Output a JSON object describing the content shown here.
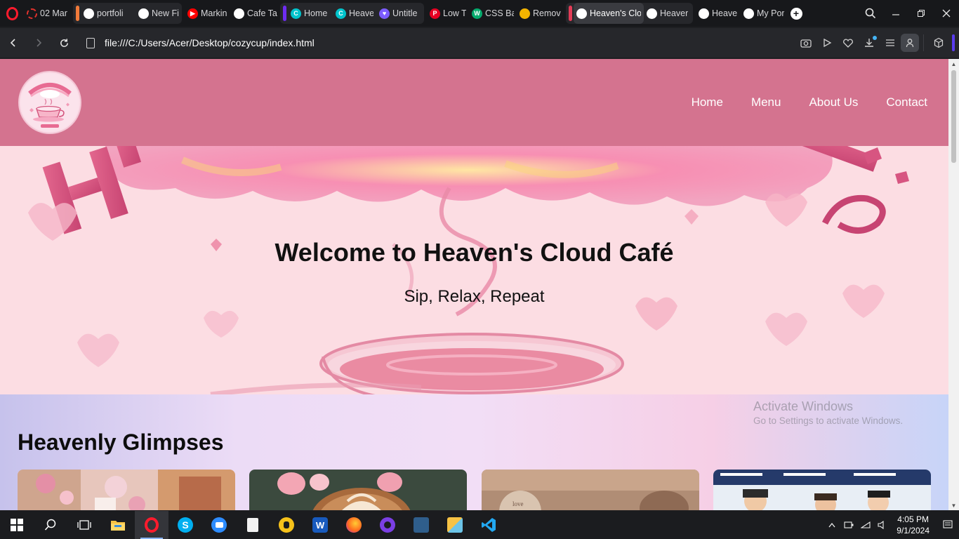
{
  "browser": {
    "tabs": [
      {
        "title": "02 Mar",
        "favicon": "loader-icon",
        "color": "#e0312c"
      },
      {
        "title": "portfoli",
        "favicon": "github-icon",
        "color": "#ffffff",
        "group": "orange"
      },
      {
        "title": "New Fil",
        "favicon": "github-icon",
        "color": "#ffffff",
        "group": "orange"
      },
      {
        "title": "Markin",
        "favicon": "youtube-icon",
        "color": "#ff0000"
      },
      {
        "title": "Cafe Ta",
        "favicon": "chatgpt-icon",
        "color": "#ffffff"
      },
      {
        "title": "Home",
        "favicon": "canva-icon",
        "color": "#00c4cc",
        "group": "purple"
      },
      {
        "title": "Heaven",
        "favicon": "canva-icon",
        "color": "#00c4cc",
        "group": "purple"
      },
      {
        "title": "Untitle",
        "favicon": "shield-heart-icon",
        "color": "#7c5cff",
        "group": "purple"
      },
      {
        "title": "Low Ti",
        "favicon": "pinterest-icon",
        "color": "#e60023"
      },
      {
        "title": "CSS Ba",
        "favicon": "w3-icon",
        "color": "#04aa6d"
      },
      {
        "title": "Remov",
        "favicon": "remove-bg-icon",
        "color": "#f4b400"
      },
      {
        "title": "Heaven's Clo",
        "favicon": "globe-icon",
        "color": "#ffffff",
        "group": "red",
        "active": true
      },
      {
        "title": "Heaver",
        "favicon": "globe-icon",
        "color": "#ffffff",
        "group": "red"
      },
      {
        "title": "Heaven",
        "favicon": "globe-icon",
        "color": "#ffffff"
      },
      {
        "title": "My Por",
        "favicon": "globe-icon",
        "color": "#ffffff"
      }
    ],
    "group_colors": {
      "orange": "#f07a3a",
      "purple": "#6e2cf2",
      "red": "#e23c57"
    },
    "new_tab": "+",
    "url": "file:///C:/Users/Acer/Desktop/cozycup/index.html"
  },
  "site": {
    "nav": [
      "Home",
      "Menu",
      "About Us",
      "Contact"
    ],
    "hero_title": "Welcome to Heaven's Cloud Café",
    "hero_tagline": "Sip, Relax, Repeat",
    "gallery_heading": "Heavenly Glimpses",
    "colors": {
      "header": "#d4738f",
      "hero": "#fcdde3"
    }
  },
  "watermark": {
    "line1": "Activate Windows",
    "line2": "Go to Settings to activate Windows."
  },
  "taskbar": {
    "time": "4:05 PM",
    "date": "9/1/2024"
  }
}
